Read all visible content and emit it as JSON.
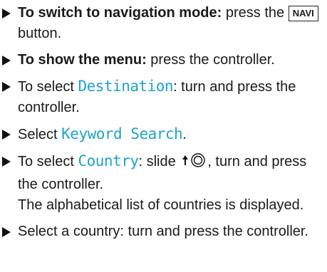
{
  "steps": [
    {
      "lead": "To switch to navigation mode:",
      "mid": " press the ",
      "key": "NAVI",
      "tail": " button."
    },
    {
      "lead": "To show the menu:",
      "tail": " press the controller."
    },
    {
      "pre": "To select ",
      "hl": "Destination",
      "tail": ": turn and press the controller."
    },
    {
      "pre": "Select ",
      "hl": "Keyword Search",
      "tail": "."
    },
    {
      "pre": "To select ",
      "hl": "Country",
      "mid": ": slide ",
      "tail": ", turn and press the controller.",
      "note": "The alphabetical list of countries is displayed."
    },
    {
      "text": "Select a country: turn and press the controller."
    }
  ],
  "icons": {
    "bullet": "triangle-right-icon",
    "slide": "slide-up-controller-icon"
  },
  "colors": {
    "highlight": "#1fa3c9",
    "text": "#1a1a1a"
  }
}
